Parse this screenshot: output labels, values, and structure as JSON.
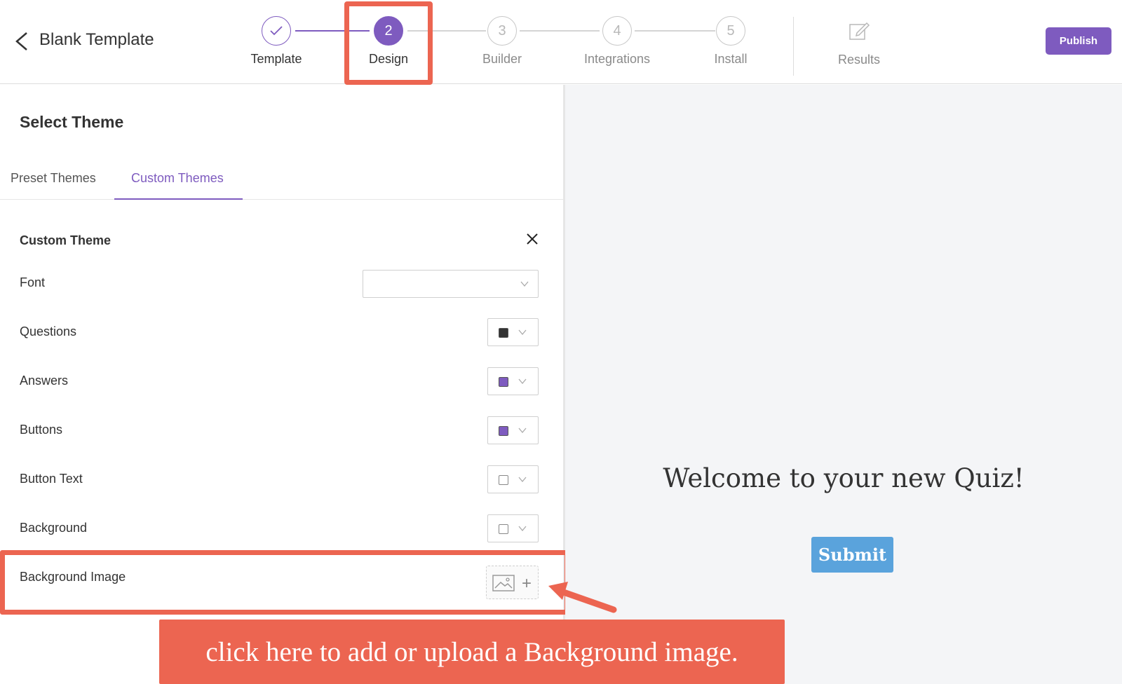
{
  "header": {
    "back_icon": "chevron-left-icon",
    "title": "Blank Template",
    "steps": [
      {
        "number": "",
        "label": "Template",
        "state": "done"
      },
      {
        "number": "2",
        "label": "Design",
        "state": "active"
      },
      {
        "number": "3",
        "label": "Builder",
        "state": "pending"
      },
      {
        "number": "4",
        "label": "Integrations",
        "state": "pending"
      },
      {
        "number": "5",
        "label": "Install",
        "state": "pending"
      }
    ],
    "results_label": "Results",
    "results_icon": "edit-icon",
    "publish_label": "Publish"
  },
  "theme_panel": {
    "heading": "Select Theme",
    "tabs": [
      {
        "label": "Preset Themes",
        "active": false
      },
      {
        "label": "Custom Themes",
        "active": true
      }
    ],
    "custom_theme_title": "Custom Theme",
    "rows": [
      {
        "label": "Font",
        "type": "select",
        "value": ""
      },
      {
        "label": "Questions",
        "type": "color",
        "color": "#333333"
      },
      {
        "label": "Answers",
        "type": "color",
        "color": "#7e5bbf"
      },
      {
        "label": "Buttons",
        "type": "color",
        "color": "#7e5bbf"
      },
      {
        "label": "Button Text",
        "type": "color",
        "color": "#ffffff"
      },
      {
        "label": "Background",
        "type": "color",
        "color": "#ffffff"
      },
      {
        "label": "Background Image",
        "type": "image"
      }
    ]
  },
  "preview": {
    "welcome_text": "Welcome to your new Quiz!",
    "submit_label": "Submit"
  },
  "annotation": {
    "callout_text": "click here to add or upload a Background image."
  },
  "colors": {
    "accent": "#7e5bbf",
    "highlight": "#ec6551",
    "submit": "#5aa3dc",
    "preview_bg": "#f4f5f7"
  }
}
